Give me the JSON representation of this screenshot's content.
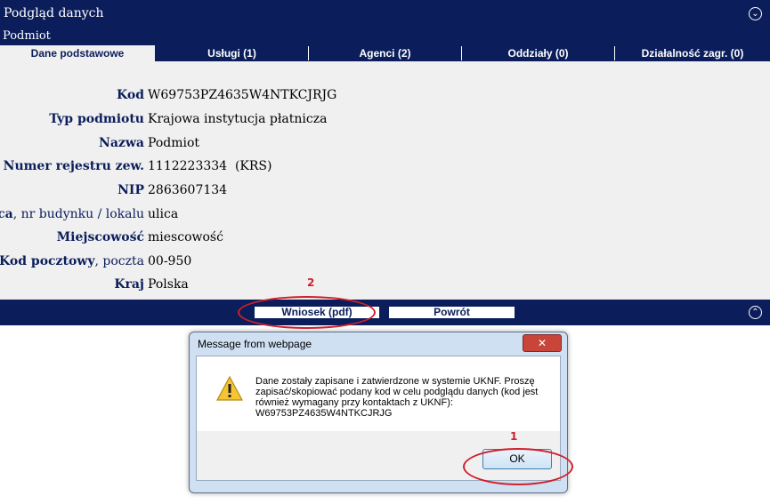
{
  "header": {
    "title": "Podgląd danych",
    "subtitle": "Podmiot",
    "collapse_icon": "collapse-icon",
    "scroll_top_icon": "scroll-top-icon"
  },
  "tabs": [
    {
      "label": "Dane podstawowe",
      "active": true
    },
    {
      "label": "Usługi (1)",
      "active": false
    },
    {
      "label": "Agenci (2)",
      "active": false
    },
    {
      "label": "Oddziały (0)",
      "active": false
    },
    {
      "label": "Działalność zagr. (0)",
      "active": false
    }
  ],
  "fields": [
    {
      "label": "Kod",
      "label_extra": "",
      "value": "W69753PZ4635W4NTKCJRJG"
    },
    {
      "label": "Typ podmiotu",
      "label_extra": "",
      "value": "Krajowa instytucja płatnicza"
    },
    {
      "label": "Nazwa",
      "label_extra": "",
      "value": "Podmiot"
    },
    {
      "label": "Numer rejestru zew.",
      "label_extra": "",
      "value": "1112223334  (KRS)"
    },
    {
      "label": "NIP",
      "label_extra": "",
      "value": "2863607134"
    },
    {
      "label": "Ulica",
      "label_extra": ", nr budynku / lokalu",
      "value": "ulica"
    },
    {
      "label": "Miejscowość",
      "label_extra": "",
      "value": "miescowość"
    },
    {
      "label": "Kod pocztowy",
      "label_extra": ", poczta",
      "value": "00-950"
    },
    {
      "label": "Kraj",
      "label_extra": "",
      "value": "Polska"
    }
  ],
  "actions": {
    "pdf_label": "Wniosek (pdf)",
    "back_label": "Powrót"
  },
  "annotations": {
    "marker_1": "1",
    "marker_2": "2"
  },
  "dialog": {
    "title": "Message from webpage",
    "close_glyph": "✕",
    "message_lines": [
      "Dane zostały zapisane i zatwierdzone w systemie UKNF. Proszę",
      "zapisać/skopiować podany kod w celu podglądu danych (kod jest",
      "również wymagany przy kontaktach z UKNF):",
      "W69753PZ4635W4NTKCJRJG"
    ],
    "ok_label": "OK",
    "icon": "warning-icon"
  },
  "colors": {
    "brand_navy": "#0b1e5b",
    "annotation_red": "#d0202a",
    "content_bg": "#f0f0f0"
  }
}
